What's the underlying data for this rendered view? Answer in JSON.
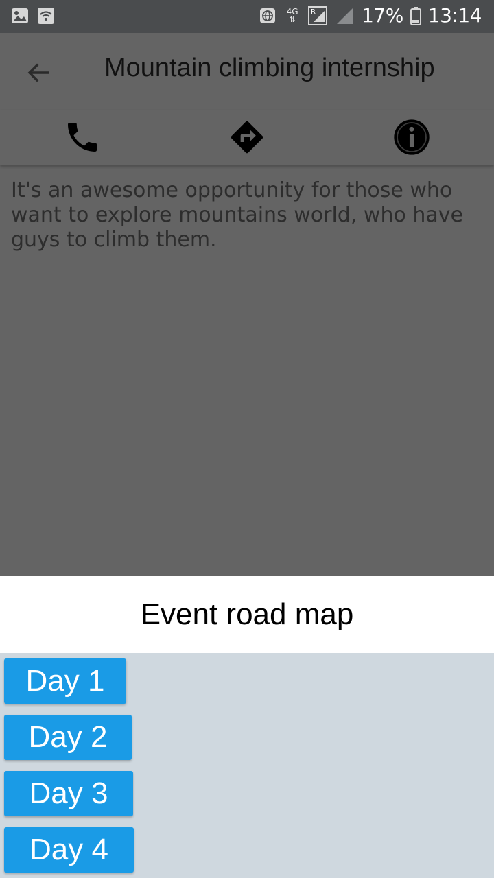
{
  "status_bar": {
    "left_icons": [
      "image-icon",
      "wifi-icon"
    ],
    "right_icons": [
      "globe-icon",
      "4g-icon",
      "roaming-signal-icon",
      "signal-icon",
      "battery-icon"
    ],
    "network_label": "4G",
    "roaming_label": "R",
    "battery": "17%",
    "time": "13:14"
  },
  "app_bar": {
    "title": "Mountain climbing internship"
  },
  "actions": {
    "call_icon": "phone-icon",
    "directions_icon": "directions-icon",
    "info_icon": "info-icon"
  },
  "event": {
    "description": "It's an awesome opportunity for those who want to explore mountains world, who have guys to climb them."
  },
  "road_map": {
    "title": "Event road map",
    "days": [
      {
        "label": "Day 1"
      },
      {
        "label": "Day 2"
      },
      {
        "label": "Day 3"
      },
      {
        "label": "Day 4"
      }
    ]
  },
  "colors": {
    "overlay": "#646464",
    "status_bar": "#4a4c4e",
    "day_button": "#1a9be6",
    "sheet_body": "#cfd8df"
  }
}
